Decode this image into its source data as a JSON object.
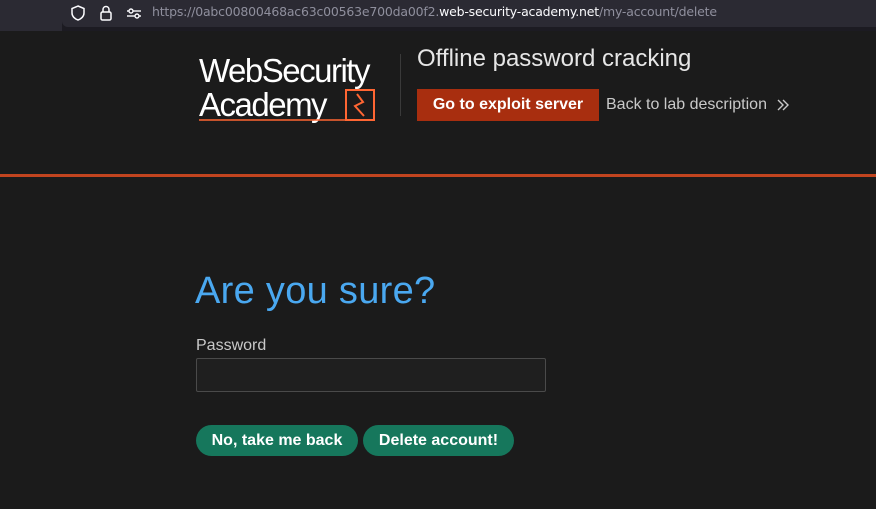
{
  "browser": {
    "url_prefix": "https://0abc00800468ac63c00563e700da00f2.",
    "url_host": "web-security-academy.net",
    "url_path": "/my-account/delete",
    "icons": [
      "shield-icon",
      "lock-icon",
      "permissions-icon"
    ]
  },
  "header": {
    "logo_line1": "WebSecurity",
    "logo_line2": "Academy",
    "lab_title": "Offline password cracking",
    "exploit_button": "Go to exploit server",
    "back_link": "Back to lab description",
    "accent_color": "#c1441f"
  },
  "main": {
    "heading": "Are you sure?",
    "password_label": "Password",
    "password_value": "",
    "cancel_button": "No, take me back",
    "delete_button": "Delete account!",
    "heading_color": "#4aa8f0",
    "button_color": "#16775c"
  }
}
